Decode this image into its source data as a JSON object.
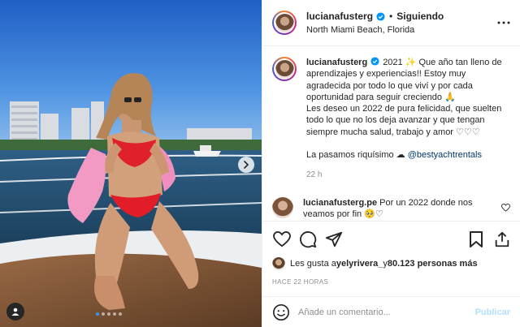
{
  "post": {
    "username": "lucianafusterg",
    "follow_status": "Siguiendo",
    "location": "North Miami Beach, Florida",
    "caption_year": "2021",
    "caption_text": "Que año tan lleno de aprendizajes y experiencias!! Estoy muy agradecida por todo lo que viví y por cada oportunidad para seguir creciendo 🙏\nLes deseo un 2022 de pura felicidad, que suelten todo lo que no los deja avanzar y que tengan siempre mucha salud, trabajo y amor ♡♡♡\n\nLa pasamos riquísimo ☁ ",
    "caption_mention": "@bestyachtrentals",
    "caption_time": "22 h",
    "sparkle_emoji": "✨"
  },
  "comment": {
    "username": "lucianafusterg.pe",
    "text": "Por un 2022 donde nos veamos por fin 🥺♡"
  },
  "likes": {
    "prefix": "Les gusta a ",
    "user": "yelyrivera_",
    "middle": " y ",
    "count": "80.123 personas más"
  },
  "time_ago": "HACE 22 HORAS",
  "add_comment": {
    "placeholder": "Añade un comentario...",
    "publish_label": "Publicar"
  },
  "carousel": {
    "total": 5,
    "active_index": 0
  },
  "colors": {
    "accent": "#0095f6",
    "verified": "#0095f6",
    "publish_disabled": "#b2dffc"
  }
}
